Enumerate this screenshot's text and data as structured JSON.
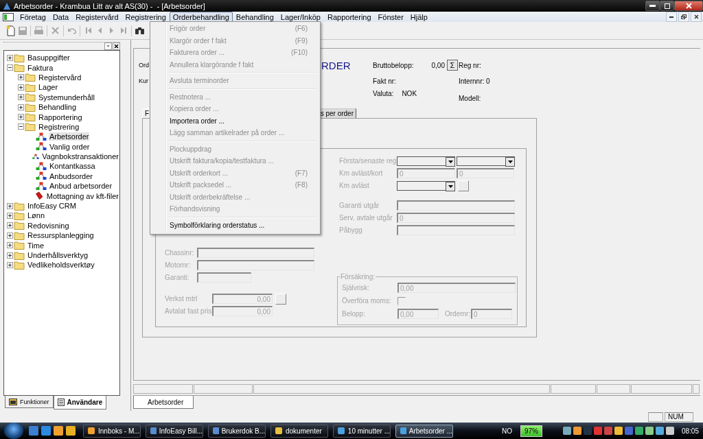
{
  "window": {
    "title": "Arbetsorder - Krambua Litt av alt AS(30) -  - [Arbetsorder]"
  },
  "menu_bar": {
    "items": [
      {
        "label": "Företag",
        "selected": false
      },
      {
        "label": "Data",
        "selected": false
      },
      {
        "label": "Registervård",
        "selected": false
      },
      {
        "label": "Registrering",
        "selected": false
      },
      {
        "label": "Orderbehandling",
        "selected": true
      },
      {
        "label": "Behandling",
        "selected": false
      },
      {
        "label": "Lager/Inköp",
        "selected": false
      },
      {
        "label": "Rapportering",
        "selected": false
      },
      {
        "label": "Fönster",
        "selected": false
      },
      {
        "label": "Hjälp",
        "selected": false
      }
    ]
  },
  "toolbar": [
    {
      "kind": "new",
      "disabled": false
    },
    {
      "kind": "save",
      "disabled": true
    },
    {
      "kind": "separator"
    },
    {
      "kind": "print",
      "disabled": true
    },
    {
      "kind": "separator"
    },
    {
      "kind": "delete",
      "disabled": true
    },
    {
      "kind": "separator"
    },
    {
      "kind": "undo",
      "disabled": true
    },
    {
      "kind": "separator"
    },
    {
      "kind": "first",
      "disabled": true
    },
    {
      "kind": "prev",
      "disabled": true
    },
    {
      "kind": "next",
      "disabled": true
    },
    {
      "kind": "last",
      "disabled": true
    },
    {
      "kind": "separator"
    },
    {
      "kind": "find",
      "disabled": false
    }
  ],
  "order_menu": {
    "items": [
      {
        "kind": "item",
        "label": "Frigör order",
        "shortcut": "(F6)",
        "disabled": true
      },
      {
        "kind": "item",
        "label": "Klargör order f fakt",
        "shortcut": "(F9)",
        "disabled": true
      },
      {
        "kind": "item",
        "label": "Fakturera order ...",
        "shortcut": "(F10)",
        "disabled": true
      },
      {
        "kind": "item",
        "label": "Annullera klargörande f fakt",
        "disabled": true
      },
      {
        "kind": "separator"
      },
      {
        "kind": "item",
        "label": "Avsluta terminorder",
        "disabled": true
      },
      {
        "kind": "separator"
      },
      {
        "kind": "item",
        "label": "Restnotera ...",
        "disabled": true
      },
      {
        "kind": "item",
        "label": "Kopiera order ...",
        "disabled": true
      },
      {
        "kind": "item",
        "label": "Importera order ...",
        "disabled": false
      },
      {
        "kind": "item",
        "label": "Lägg samman artikelrader på order ...",
        "disabled": true
      },
      {
        "kind": "separator"
      },
      {
        "kind": "item",
        "label": "Plockuppdrag",
        "disabled": true
      },
      {
        "kind": "item",
        "label": "Utskrift faktura/kopia/testfaktura ...",
        "disabled": true
      },
      {
        "kind": "item",
        "label": "Utskrift orderkort ...",
        "shortcut": "(F7)",
        "disabled": true
      },
      {
        "kind": "item",
        "label": "Utskrift packsedel  ...",
        "shortcut": "(F8)",
        "disabled": true
      },
      {
        "kind": "item",
        "label": "Utskrift orderbekräftelse ...",
        "disabled": true
      },
      {
        "kind": "item",
        "label": "Förhandsvisning",
        "disabled": true
      },
      {
        "kind": "separator"
      },
      {
        "kind": "item",
        "label": "Symbolförklaring orderstatus ...",
        "disabled": false
      }
    ]
  },
  "navigator": {
    "tree": [
      {
        "label": "Basuppgifter",
        "kind": "folder",
        "expanded": false,
        "selected": false
      },
      {
        "label": "Faktura",
        "kind": "folder",
        "expanded": true,
        "selected": false,
        "children": [
          {
            "label": "Registervård",
            "kind": "folder",
            "expanded": false,
            "selected": false
          },
          {
            "label": "Lager",
            "kind": "folder",
            "expanded": false,
            "selected": false
          },
          {
            "label": "Systemunderhåll",
            "kind": "folder",
            "expanded": false,
            "selected": false
          },
          {
            "label": "Behandling",
            "kind": "folder",
            "expanded": false,
            "selected": false
          },
          {
            "label": "Rapportering",
            "kind": "folder",
            "expanded": false,
            "selected": false
          },
          {
            "label": "Registrering",
            "kind": "folder",
            "expanded": true,
            "selected": false,
            "children": [
              {
                "label": "Arbetsorder",
                "kind": "form",
                "selected": true
              },
              {
                "label": "Vanlig order",
                "kind": "form",
                "selected": false
              },
              {
                "label": "Vagnbokstransaktioner",
                "kind": "form",
                "selected": false
              },
              {
                "label": "Kontantkassa",
                "kind": "form",
                "selected": false
              },
              {
                "label": "Anbudsorder",
                "kind": "form",
                "selected": false
              },
              {
                "label": "Anbud arbetsorder",
                "kind": "form",
                "selected": false
              },
              {
                "label": "Mottagning av kft-filer",
                "kind": "import",
                "selected": false
              }
            ]
          }
        ]
      },
      {
        "label": "InfoEasy CRM",
        "kind": "folder",
        "expanded": false,
        "selected": false
      },
      {
        "label": "Lønn",
        "kind": "folder",
        "expanded": false,
        "selected": false
      },
      {
        "label": "Redovisning",
        "kind": "folder",
        "expanded": false,
        "selected": false
      },
      {
        "label": "Ressursplanlegging",
        "kind": "folder",
        "expanded": false,
        "selected": false
      },
      {
        "label": "Time",
        "kind": "folder",
        "expanded": false,
        "selected": false
      },
      {
        "label": "Underhållsverktyg",
        "kind": "folder",
        "expanded": false,
        "selected": false
      },
      {
        "label": "Vedlikeholdsverktøy",
        "kind": "folder",
        "expanded": false,
        "selected": false
      }
    ],
    "tabs": [
      {
        "label": "Funktioner",
        "selected": false
      },
      {
        "label": "Användare",
        "selected": true
      }
    ]
  },
  "order_form": {
    "header": {
      "label_1": "Ord",
      "label_2": "Kur",
      "heading": "RDER",
      "gross_label": "Bruttobelopp:",
      "gross_value": "0,00",
      "sum_button": "Σ",
      "reg_label": "Reg nr:",
      "invoice_label": "Fakt nr:",
      "internal": "Internnr: 0",
      "currency_label": "Valuta:",
      "currency_value": "NOK",
      "model_label": "Modell:"
    },
    "tabs": [
      {
        "label": "F",
        "selected": true
      },
      {
        "label": "s per order",
        "selected": false
      }
    ],
    "vehicle": {
      "disabled": true,
      "left_groups": [
        {
          "rows": [
            {
              "kind": "input_wide",
              "label": "Chassinr:"
            },
            {
              "kind": "input_wide",
              "label": "Motornr:"
            },
            {
              "kind": "input_short",
              "label": "Garanti:"
            }
          ]
        },
        {
          "rows": [
            {
              "kind": "amount_button",
              "label": "Verkst mtrl",
              "value": "0,00"
            },
            {
              "kind": "amount",
              "label": "Avtalat fast pris:",
              "value": "0,00"
            }
          ]
        }
      ],
      "right_groups": [
        {
          "rows": [
            {
              "kind": "combo_pair",
              "label": "Första/senaste reg"
            },
            {
              "kind": "input_pair",
              "label": "Km avläst/kort",
              "value": "0",
              "value_2": "0"
            },
            {
              "kind": "combo_button",
              "label": "Km avläst"
            }
          ]
        },
        {
          "rows": [
            {
              "kind": "input",
              "label": "Garanti utgår"
            },
            {
              "kind": "input",
              "label": "Serv. avtale utgår",
              "value": "0"
            },
            {
              "kind": "input",
              "label": "Påbygg"
            }
          ]
        }
      ],
      "insurance": {
        "title": "Försäkring:",
        "rows": [
          {
            "kind": "input",
            "label": "Självrisk:",
            "value": "0,00"
          },
          {
            "kind": "checkbox",
            "label": "Överföra moms:",
            "checked": false
          },
          {
            "kind": "input_pair",
            "label": "Belopp:",
            "value": "0,00",
            "label_2": "Ordernr:",
            "value_2": "0"
          }
        ]
      }
    }
  },
  "mdi_tabs": [
    {
      "label": "Arbetsorder",
      "selected": true
    }
  ],
  "status_bar": {
    "cells": [
      "NUM"
    ]
  },
  "taskbar": {
    "tasks": [
      {
        "label": "Innboks - M...",
        "selected": false
      },
      {
        "label": "InfoEasy Bill...",
        "selected": false
      },
      {
        "label": "Brukerdok B...",
        "selected": false
      },
      {
        "label": "dokumenter",
        "selected": false
      },
      {
        "label": "10 minutter ...",
        "selected": false
      },
      {
        "label": "Arbetsorder ...",
        "selected": true
      }
    ],
    "language": "NO",
    "battery": "97%",
    "clock": "08:05"
  }
}
